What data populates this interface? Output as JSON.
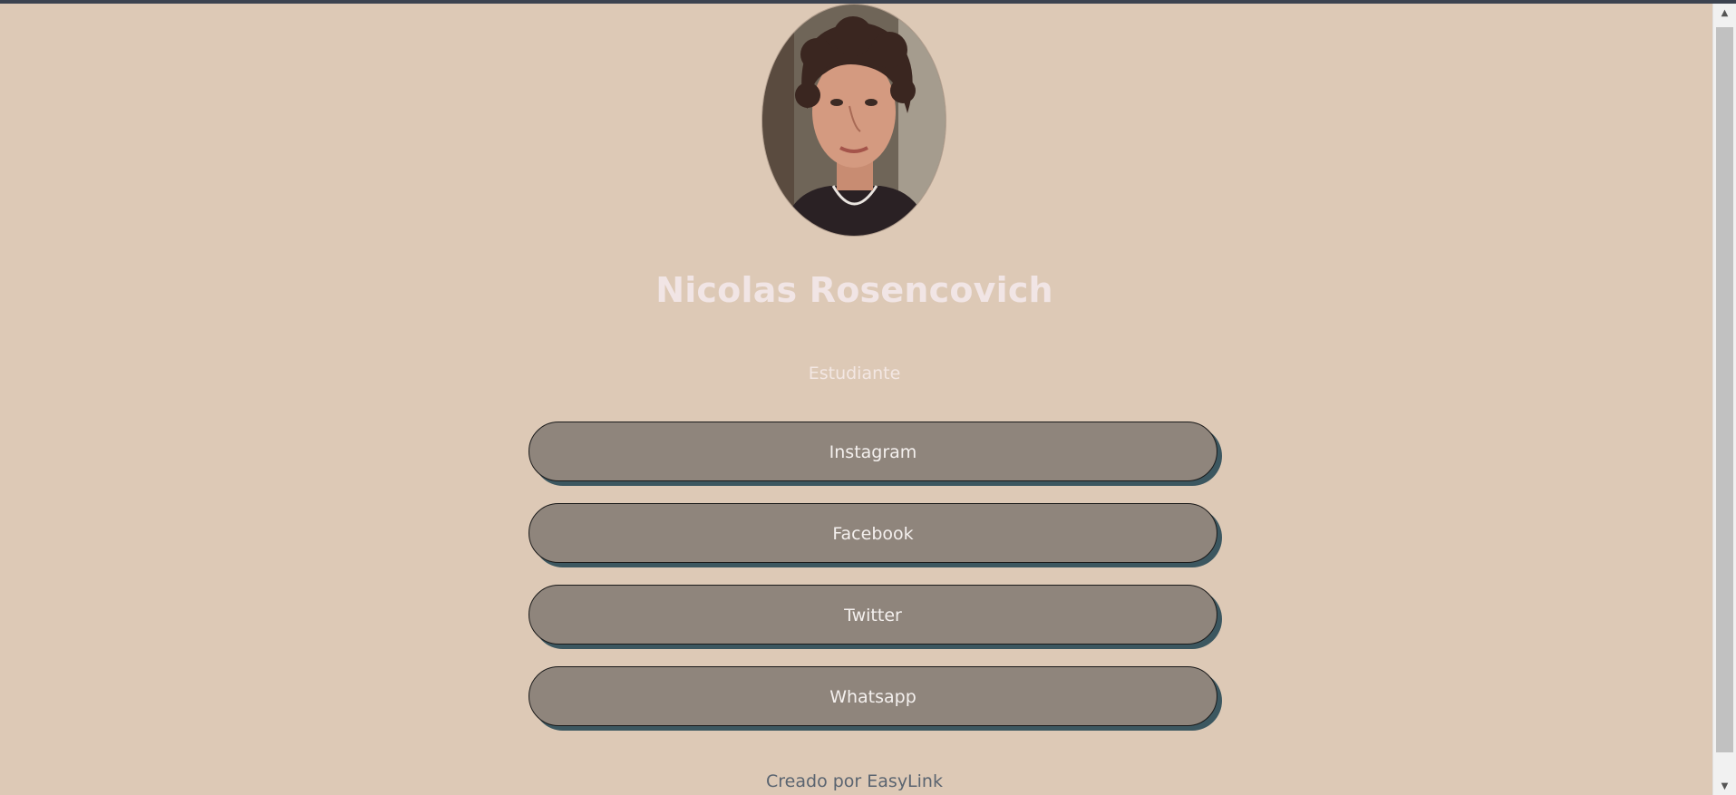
{
  "profile": {
    "name": "Nicolas Rosencovich",
    "subtitle": "Estudiante"
  },
  "links": [
    {
      "label": "Instagram"
    },
    {
      "label": "Facebook"
    },
    {
      "label": "Twitter"
    },
    {
      "label": "Whatsapp"
    }
  ],
  "footer": {
    "text": "Creado por EasyLink"
  },
  "colors": {
    "background": "#ddc9b6",
    "button": "#8f857c",
    "button_shadow": "#3c5760",
    "name_text": "#f1e5e5",
    "footer_text": "#5a6470"
  },
  "icons": {
    "scroll_up": "scroll-up-arrow-icon",
    "scroll_down": "scroll-down-arrow-icon"
  }
}
